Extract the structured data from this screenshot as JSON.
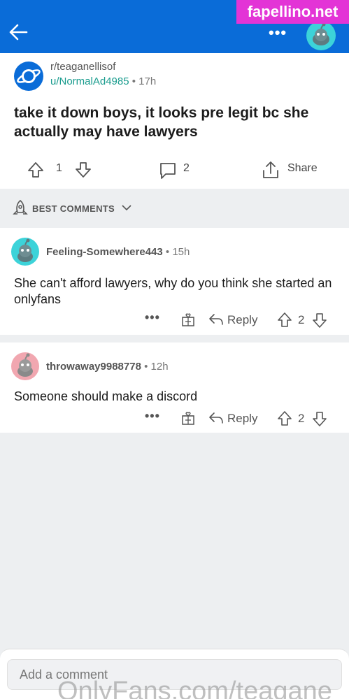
{
  "topbar": {
    "more_label": "•••",
    "bg": "#0a6cd8"
  },
  "watermark_top": "fapellino.net",
  "post": {
    "subreddit": "r/teaganellisof",
    "author": "u/NormalAd4985",
    "time": "• 17h",
    "title": "take it down boys, it looks pre legit bc she actually may have lawyers",
    "votes": "1",
    "comments": "2",
    "share_label": "Share"
  },
  "sort": {
    "label": "BEST COMMENTS"
  },
  "comments": [
    {
      "author": "Feeling-Somewhere443",
      "time": "• 15h",
      "body": "She can't afford lawyers, why do you think she started an onlyfans",
      "more": "•••",
      "reply": "Reply",
      "score": "2",
      "avatar_color": "#3cd3d9"
    },
    {
      "author": "throwaway9988778",
      "time": "• 12h",
      "body": "Someone should make a discord",
      "more": "•••",
      "reply": "Reply",
      "score": "2",
      "avatar_color": "#f1a7b0"
    }
  ],
  "composer": {
    "placeholder": "Add a comment"
  },
  "watermark_bottom": "OnlyFans.com/teagane"
}
